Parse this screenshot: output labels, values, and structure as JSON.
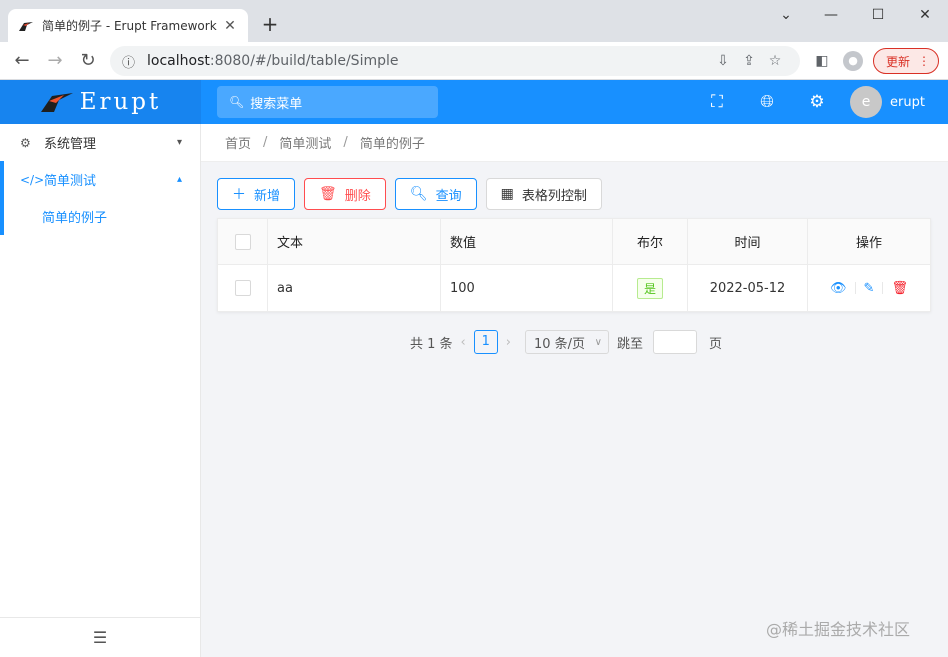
{
  "browser": {
    "tab_title": "简单的例子 - Erupt Framework",
    "tab_close": "✕",
    "new_tab": "+",
    "url_host": "localhost",
    "url_rest": ":8080/#/build/table/Simple",
    "update_label": "更新"
  },
  "header": {
    "logo_text": "Erupt",
    "search_placeholder": "搜索菜单",
    "username": "erupt",
    "avatar_letter": "e"
  },
  "sidebar": {
    "items": [
      {
        "label": "系统管理"
      },
      {
        "label": "简单测试"
      }
    ],
    "sub_items": [
      {
        "label": "简单的例子"
      }
    ]
  },
  "breadcrumb": [
    "首页",
    "简单测试",
    "简单的例子"
  ],
  "breadcrumb_sep": "/",
  "toolbar": {
    "add": "新增",
    "delete": "删除",
    "query": "查询",
    "columns": "表格列控制"
  },
  "table": {
    "columns": [
      "文本",
      "数值",
      "布尔",
      "时间",
      "操作"
    ],
    "rows": [
      {
        "text": "aa",
        "number": "100",
        "bool": "是",
        "time": "2022-05-12"
      }
    ]
  },
  "pager": {
    "total": "共 1 条",
    "current": "1",
    "size": "10 条/页",
    "jump": "跳至",
    "page": "页"
  },
  "watermark": "@稀土掘金技术社区"
}
